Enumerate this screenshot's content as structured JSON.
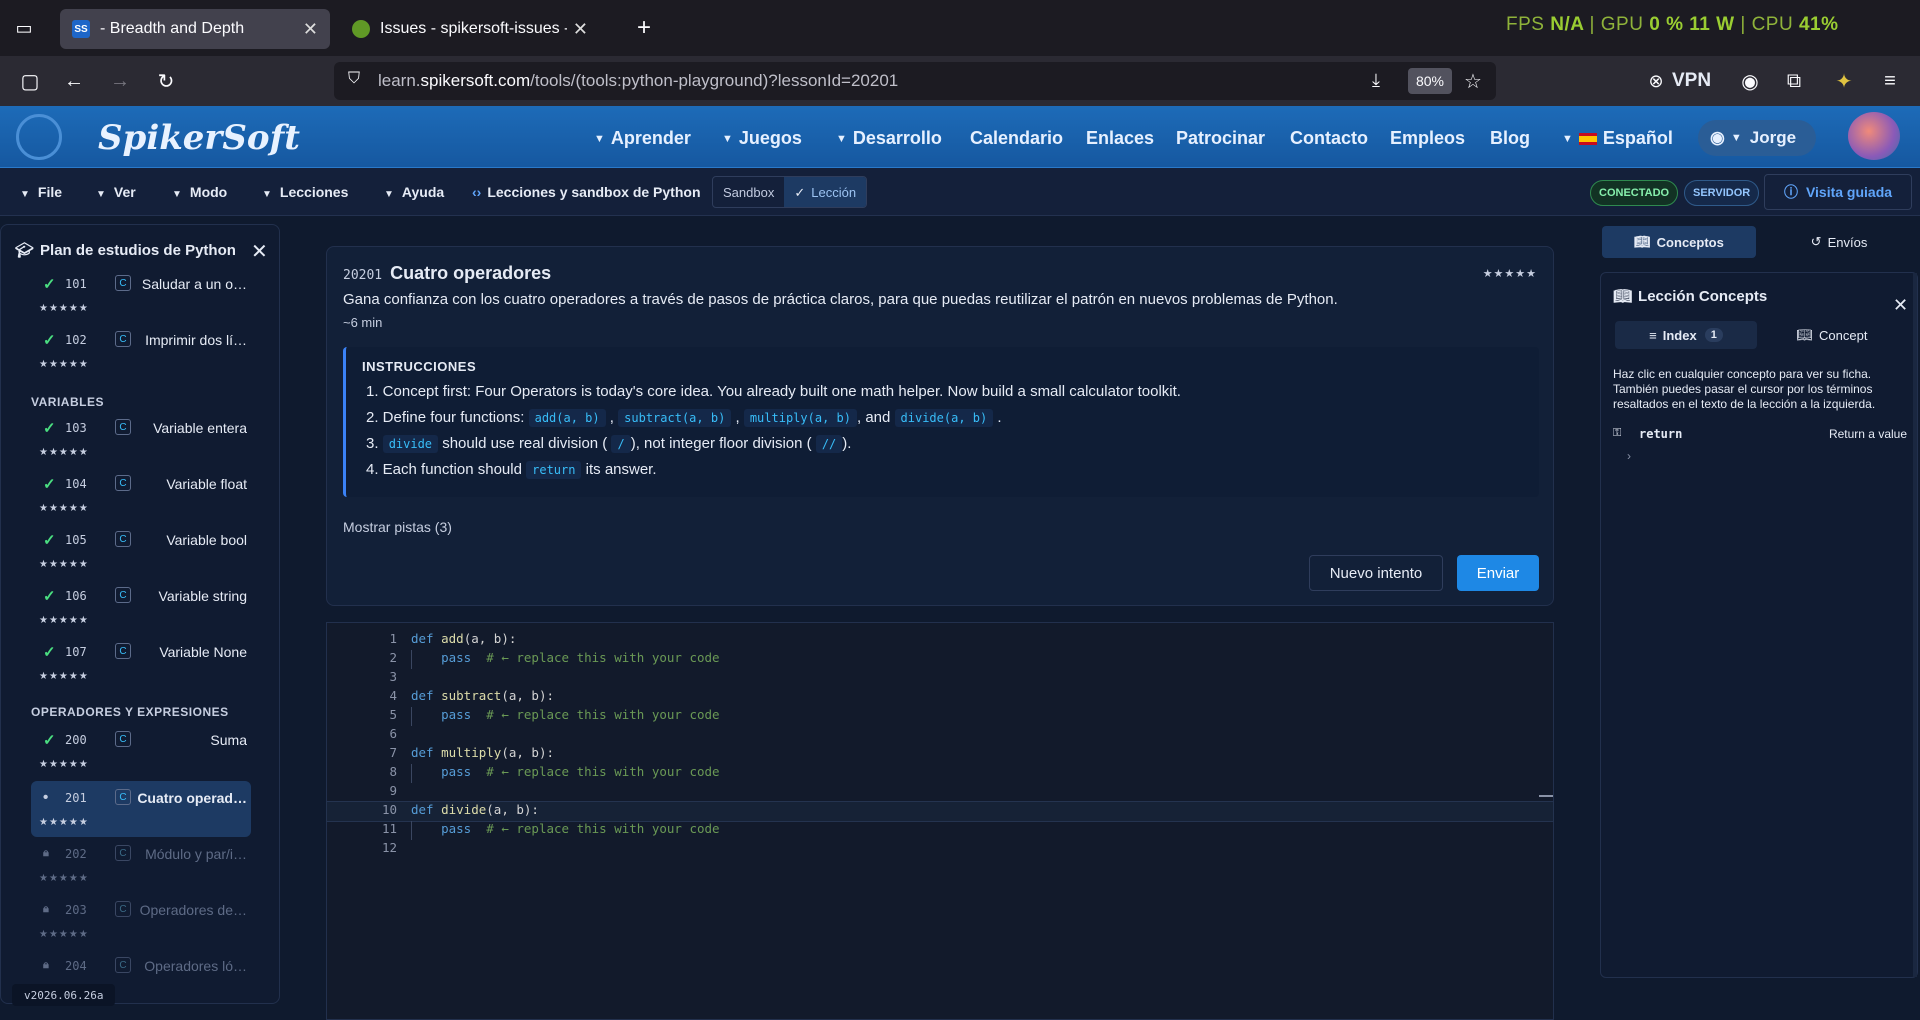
{
  "browser": {
    "tabs": [
      {
        "title": " - Breadth and Depth",
        "favicon": "SS"
      },
      {
        "title": "Issues - spikersoft-issues - Gitea"
      }
    ],
    "url_prefix": "learn.",
    "url_domain": "spikersoft.com",
    "url_path": "/tools/(tools:python-playground)?lessonId=20201",
    "zoom": "80%",
    "vpn_label": "VPN",
    "perf": {
      "fps_label": "FPS",
      "fps": "N/A",
      "gpu_label": "GPU",
      "gpu": "0 %",
      "gpu_w": "11 W",
      "cpu_label": "CPU",
      "cpu": "41%"
    }
  },
  "site": {
    "logo": "SpikerSoft",
    "menu": [
      "Aprender",
      "Juegos",
      "Desarrollo",
      "Calendario",
      "Enlaces",
      "Patrocinar",
      "Contacto",
      "Empleos",
      "Blog",
      "Español"
    ],
    "user": "Jorge"
  },
  "toolbar": {
    "menus": [
      "File",
      "Ver",
      "Modo",
      "Lecciones",
      "Ayuda"
    ],
    "title": "Lecciones y sandbox de Python",
    "mode_sandbox": "Sandbox",
    "mode_lesson": "Lección",
    "badge_connected": "CONECTADO",
    "badge_server": "SERVIDOR",
    "tour": "Visita guiada"
  },
  "sidebar": {
    "title": "Plan de estudios de Python",
    "sections": [
      "VARIABLES",
      "OPERADORES Y EXPRESIONES"
    ],
    "lessons": [
      {
        "num": "101",
        "name": "Saludar a un o…",
        "stars": "★★★★★"
      },
      {
        "num": "102",
        "name": "Imprimir dos lí…",
        "stars": "★★★★★"
      },
      {
        "num": "103",
        "name": "Variable entera",
        "stars": "★★★★★"
      },
      {
        "num": "104",
        "name": "Variable float",
        "stars": "★★★★★"
      },
      {
        "num": "105",
        "name": "Variable bool",
        "stars": "★★★★★"
      },
      {
        "num": "106",
        "name": "Variable string",
        "stars": "★★★★★"
      },
      {
        "num": "107",
        "name": "Variable None",
        "stars": "★★★★★"
      },
      {
        "num": "200",
        "name": "Suma",
        "stars": "★★★★★"
      },
      {
        "num": "201",
        "name": "Cuatro operad…",
        "stars": "★★★★★"
      },
      {
        "num": "202",
        "name": "Módulo y par/i…",
        "stars": "★★★★★"
      },
      {
        "num": "203",
        "name": "Operadores de…",
        "stars": "★★★★★"
      },
      {
        "num": "204",
        "name": "Operadores ló…",
        "stars": ""
      }
    ],
    "icon_letter": "C",
    "version": "v2026.06.26a"
  },
  "lesson": {
    "id": "20201",
    "title": "Cuatro operadores",
    "stars": "★★★★★",
    "desc": "Gana confianza con los cuatro operadores a través de pasos de práctica claros, para que puedas reutilizar el patrón en nuevos problemas de Python.",
    "duration": "~6 min",
    "instructions_label": "INSTRUCCIONES",
    "step1": "1. Concept first: Four Operators is today's core idea. You already built one math helper. Now build a small calculator toolkit.",
    "step2_pre": "2. Define four functions:",
    "step2_c1": "add(a, b)",
    "step2_c2": "subtract(a, b)",
    "step2_c3": "multiply(a, b)",
    "step2_and": ", and",
    "step2_c4": "divide(a, b)",
    "step3_pre": "3.",
    "step3_c1": "divide",
    "step3_mid": "should use real division (",
    "step3_c2": "/",
    "step3_mid2": "), not integer floor division (",
    "step3_c3": "//",
    "step3_end": ").",
    "step4_pre": "4. Each function should",
    "step4_c1": "return",
    "step4_end": "its answer.",
    "hints": "Mostrar pistas (3)",
    "retry": "Nuevo intento",
    "submit": "Enviar"
  },
  "editor": {
    "active_line": 10,
    "lines": [
      {
        "n": "1",
        "kw": "def",
        "fn": "add",
        "rest": "(a, b):",
        "cm": ""
      },
      {
        "n": "2",
        "kw": "    pass",
        "fn": "",
        "rest": "  ",
        "cm": "# ← replace this with your code"
      },
      {
        "n": "3",
        "kw": "",
        "fn": "",
        "rest": "",
        "cm": ""
      },
      {
        "n": "4",
        "kw": "def",
        "fn": "subtract",
        "rest": "(a, b):",
        "cm": ""
      },
      {
        "n": "5",
        "kw": "    pass",
        "fn": "",
        "rest": "  ",
        "cm": "# ← replace this with your code"
      },
      {
        "n": "6",
        "kw": "",
        "fn": "",
        "rest": "",
        "cm": ""
      },
      {
        "n": "7",
        "kw": "def",
        "fn": "multiply",
        "rest": "(a, b):",
        "cm": ""
      },
      {
        "n": "8",
        "kw": "    pass",
        "fn": "",
        "rest": "  ",
        "cm": "# ← replace this with your code"
      },
      {
        "n": "9",
        "kw": "",
        "fn": "",
        "rest": "",
        "cm": ""
      },
      {
        "n": "10",
        "kw": "def",
        "fn": "divide",
        "rest": "(a, b):",
        "cm": ""
      },
      {
        "n": "11",
        "kw": "    pass",
        "fn": "",
        "rest": "  ",
        "cm": "# ← replace this with your code"
      },
      {
        "n": "12",
        "kw": "",
        "fn": "",
        "rest": "",
        "cm": ""
      }
    ]
  },
  "right": {
    "tab_concepts": "Conceptos",
    "tab_submissions": "Envíos",
    "panel_title": "Lección Concepts",
    "subtab_index": "Index",
    "index_count": "1",
    "subtab_concept": "Concept",
    "help": "Haz clic en cualquier concepto para ver su ficha. También puedes pasar el cursor por los términos resaltados en el texto de la lección a la izquierda.",
    "term": "return",
    "term_desc": "Return a value"
  }
}
